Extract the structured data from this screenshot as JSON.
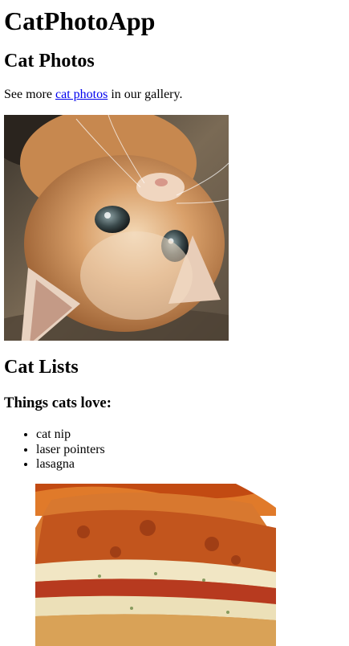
{
  "header": {
    "app_title": "CatPhotoApp"
  },
  "photos_section": {
    "heading": "Cat Photos",
    "intro_before": "See more ",
    "intro_link": "cat photos",
    "intro_after": " in our gallery."
  },
  "images": {
    "cat": "relaxing-cat-image",
    "lasagna": "lasagna-image"
  },
  "lists_section": {
    "heading": "Cat Lists",
    "subheading": "Things cats love:",
    "items": [
      "cat nip",
      "laser pointers",
      "lasagna"
    ]
  },
  "colors": {
    "link": "#0000ee",
    "text": "#000000",
    "background": "#ffffff"
  }
}
